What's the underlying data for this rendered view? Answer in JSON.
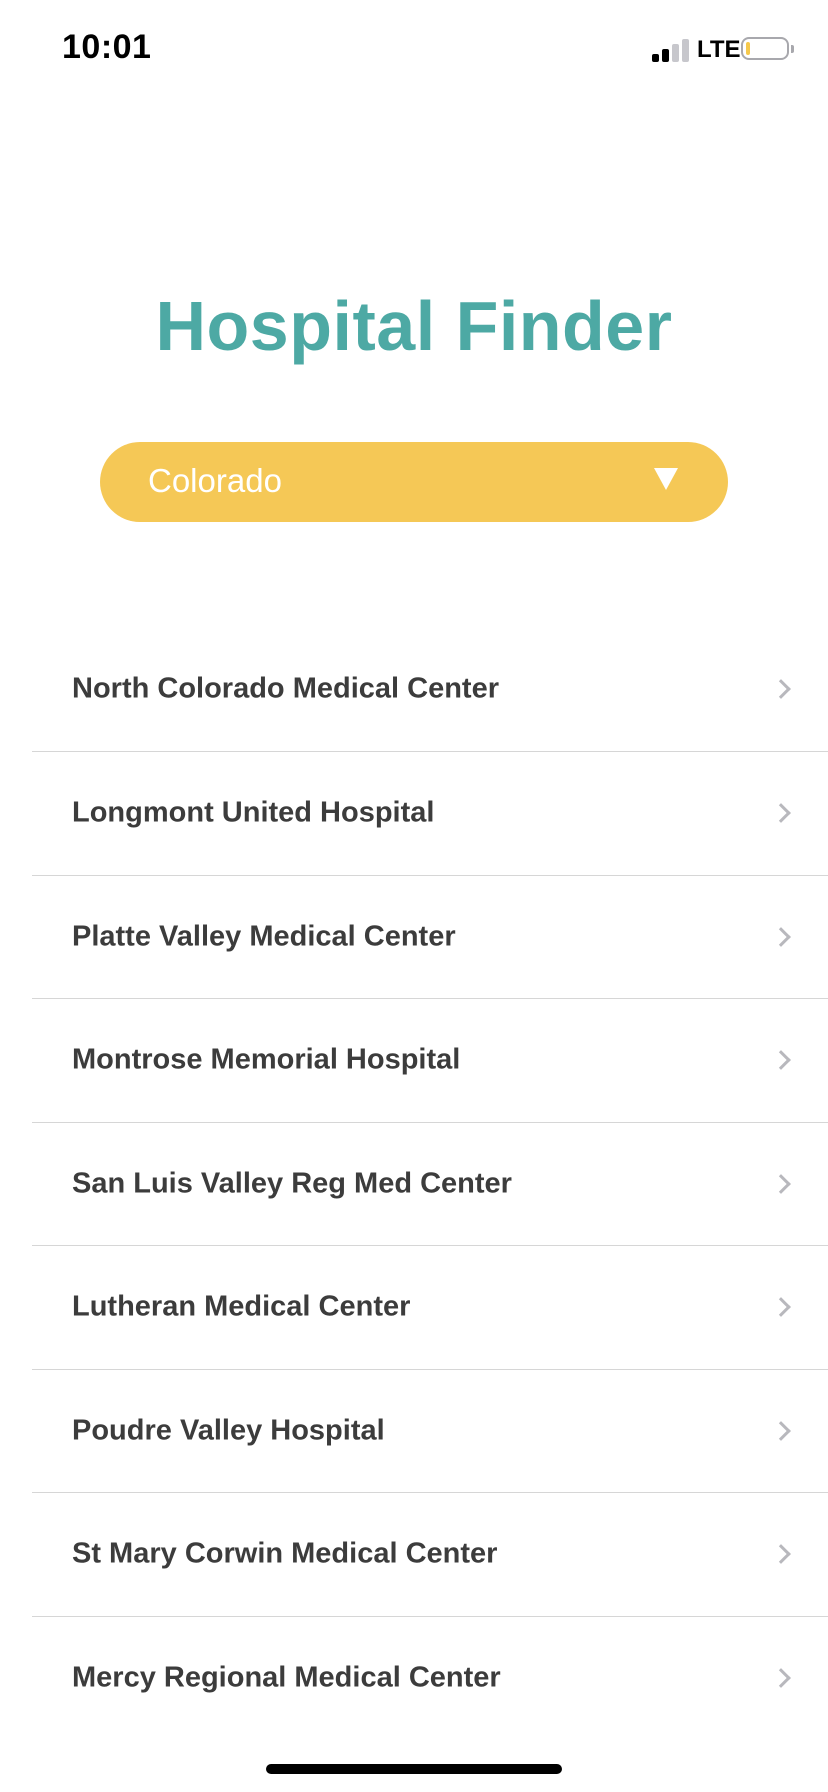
{
  "status_bar": {
    "time": "10:01",
    "network": "LTE",
    "battery_level": 0.1,
    "signal_bars": 2,
    "signal_bars_total": 4,
    "battery_color": "#f5c84b"
  },
  "header": {
    "title": "Hospital Finder",
    "title_color": "#4da9a4"
  },
  "state_selector": {
    "selected": "Colorado",
    "icon": "triangle-down-icon",
    "background_color": "#f5c856"
  },
  "hospitals": [
    {
      "name": "North Colorado Medical Center",
      "icon": "chevron-right-icon"
    },
    {
      "name": "Longmont United Hospital",
      "icon": "chevron-right-icon"
    },
    {
      "name": "Platte Valley Medical Center",
      "icon": "chevron-right-icon"
    },
    {
      "name": "Montrose Memorial Hospital",
      "icon": "chevron-right-icon"
    },
    {
      "name": "San Luis Valley Reg Med Center",
      "icon": "chevron-right-icon"
    },
    {
      "name": "Lutheran Medical Center",
      "icon": "chevron-right-icon"
    },
    {
      "name": "Poudre Valley Hospital",
      "icon": "chevron-right-icon"
    },
    {
      "name": "St Mary Corwin Medical Center",
      "icon": "chevron-right-icon"
    },
    {
      "name": "Mercy Regional Medical Center",
      "icon": "chevron-right-icon"
    }
  ]
}
